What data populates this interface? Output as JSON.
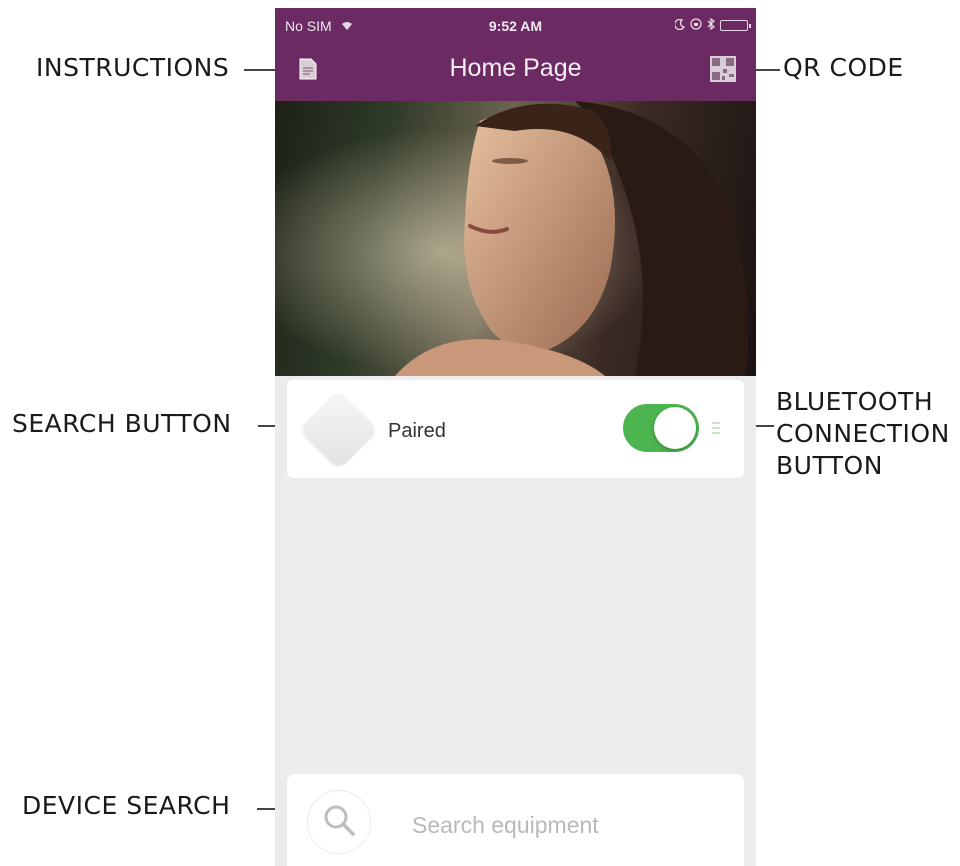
{
  "callouts": {
    "instructions": "INSTRUCTIONS",
    "qr_code": "QR CODE",
    "search_button": "SEARCH BUTTON",
    "bluetooth": "BLUETOOTH\nCONNECTION\nBUTTON",
    "device_search": "DEVICE SEARCH"
  },
  "status_bar": {
    "carrier": "No SIM",
    "time": "9:52 AM"
  },
  "nav": {
    "title": "Home Page",
    "left_icon": "document-icon",
    "right_icon": "qr-code-icon"
  },
  "device_card": {
    "status": "Paired",
    "toggle_on": true
  },
  "search": {
    "placeholder": "Search equipment"
  },
  "colors": {
    "header": "#6b2a62",
    "toggle_on": "#4cb54f",
    "background": "#ececec"
  }
}
